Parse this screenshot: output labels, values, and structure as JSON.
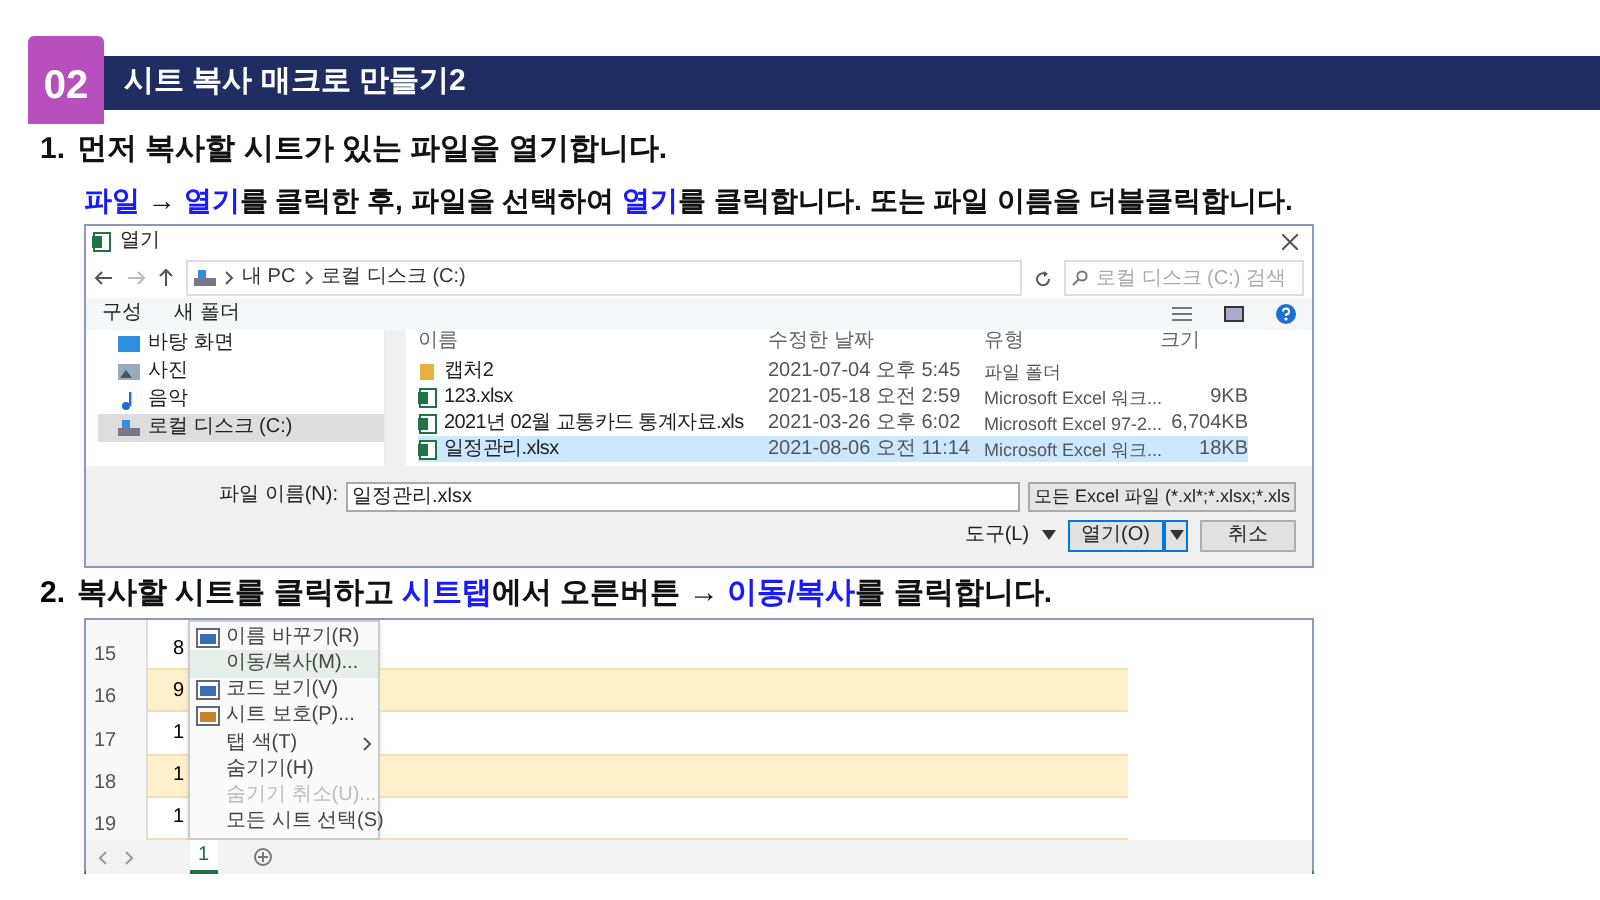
{
  "section": {
    "number": "02",
    "title": "시트 복사 매크로 만들기2"
  },
  "step1": {
    "number": "1.",
    "text": "먼저 복사할 시트가 있는 파일을 열기합니다.",
    "detail": [
      {
        "text": "파일",
        "highlight": true
      },
      {
        "text": " → ",
        "highlight": false
      },
      {
        "text": "열기",
        "highlight": true
      },
      {
        "text": "를 클릭한 후, 파일을 선택하여 ",
        "highlight": false
      },
      {
        "text": "열기",
        "highlight": true
      },
      {
        "text": "를 클릭합니다. 또는 파일 이름을 더블클릭합니다.",
        "highlight": false
      }
    ]
  },
  "dialog": {
    "title": "열기",
    "path": [
      "내 PC",
      "로컬 디스크 (C:)"
    ],
    "search": {
      "placeholder": "로컬 디스크 (C:) 검색"
    },
    "toolbar": [
      "구성",
      "새 폴더"
    ],
    "nav": [
      {
        "label": "바탕 화면",
        "kind": "desktop",
        "selected": false
      },
      {
        "label": "사진",
        "kind": "pictures",
        "selected": false
      },
      {
        "label": "음악",
        "kind": "music",
        "selected": false
      },
      {
        "label": "로컬 디스크 (C:)",
        "kind": "drive",
        "selected": true
      }
    ],
    "columns": [
      "이름",
      "수정한 날짜",
      "유형",
      "크기"
    ],
    "files": [
      {
        "kind": "folder",
        "name": "캡처2",
        "date": "2021-07-04 오후 5:45",
        "type": "파일 폴더",
        "selected": false
      },
      {
        "kind": "excel",
        "name": "123.xlsx",
        "date": "2021-05-18 오전 2:59",
        "type": "Microsoft Excel 워크...",
        "size": "9KB",
        "selected": false
      },
      {
        "kind": "excel",
        "name": "2021년 02월  교통카드 통계자료.xls",
        "date": "2021-03-26 오후 6:02",
        "type": "Microsoft Excel 97-2...",
        "size": "6,704KB",
        "selected": false
      },
      {
        "kind": "excel",
        "name": "일정관리.xlsx",
        "date": "2021-08-06 오전 11:14",
        "type": "Microsoft Excel 워크...",
        "size": "18KB",
        "selected": true
      }
    ],
    "filename_label": "파일 이름(N):",
    "filename": "일정관리.xlsx",
    "filter": "모든 Excel 파일 (*.xl*;*.xlsx;*.xls",
    "tools": "도구(L)",
    "open": "열기(O)",
    "cancel": "취소"
  },
  "step2": {
    "number": "2.",
    "detail": [
      {
        "text": "복사할 시트를 클릭하고 ",
        "highlight": false
      },
      {
        "text": "시트탭",
        "highlight": true
      },
      {
        "text": "에서 오른버튼 → ",
        "highlight": false
      },
      {
        "text": "이동/복사",
        "highlight": true
      },
      {
        "text": "를 클릭합니다.",
        "highlight": false
      }
    ]
  },
  "sheet": {
    "rows": [
      {
        "number": "15",
        "cell": "8",
        "shaded": false
      },
      {
        "number": "16",
        "cell": "9",
        "shaded": true
      },
      {
        "number": "17",
        "cell": "1",
        "shaded": false
      },
      {
        "number": "18",
        "cell": "1",
        "shaded": true
      },
      {
        "number": "19",
        "cell": "1",
        "shaded": false
      }
    ],
    "tab": "1",
    "menu": [
      {
        "label": "이름 바꾸기(R)",
        "kind": "rename",
        "disabled": false,
        "selected": false
      },
      {
        "label": "이동/복사(M)...",
        "kind": "plain",
        "disabled": false,
        "selected": true
      },
      {
        "label": "코드 보기(V)",
        "kind": "code",
        "disabled": false,
        "selected": false
      },
      {
        "label": "시트 보호(P)...",
        "kind": "protect",
        "disabled": false,
        "selected": false
      },
      {
        "label": "탭 색(T)",
        "kind": "submenu",
        "disabled": false,
        "selected": false
      },
      {
        "label": "숨기기(H)",
        "kind": "plain",
        "disabled": false,
        "selected": false
      },
      {
        "label": "숨기기 취소(U)...",
        "kind": "plain",
        "disabled": true,
        "selected": false
      },
      {
        "label": "모든 시트 선택(S)",
        "kind": "plain",
        "disabled": false,
        "selected": false
      }
    ]
  }
}
